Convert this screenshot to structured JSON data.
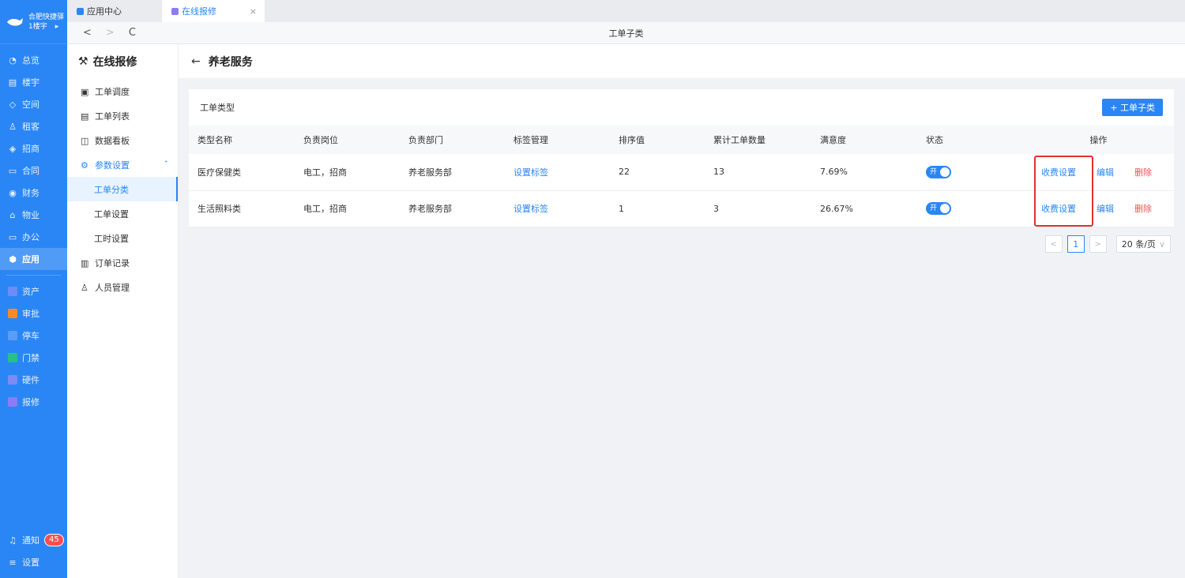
{
  "org": {
    "name": "合肥快捷驿",
    "building": "1楼宇"
  },
  "nav": {
    "items": [
      {
        "label": "总览",
        "icon": "dashboard-icon"
      },
      {
        "label": "楼宇",
        "icon": "building-icon"
      },
      {
        "label": "空间",
        "icon": "cube-icon"
      },
      {
        "label": "租客",
        "icon": "tenant-icon"
      },
      {
        "label": "招商",
        "icon": "tag-icon"
      },
      {
        "label": "合同",
        "icon": "contract-icon"
      },
      {
        "label": "财务",
        "icon": "finance-icon"
      },
      {
        "label": "物业",
        "icon": "home-icon"
      },
      {
        "label": "办公",
        "icon": "monitor-icon"
      },
      {
        "label": "应用",
        "icon": "app-icon"
      }
    ],
    "apps": [
      {
        "label": "资产",
        "color": "#6e8cf7"
      },
      {
        "label": "审批",
        "color": "#f58a2a"
      },
      {
        "label": "停车",
        "color": "#5b9cf7"
      },
      {
        "label": "门禁",
        "color": "#27c08a"
      },
      {
        "label": "硬件",
        "color": "#7b8cf5"
      },
      {
        "label": "报修",
        "color": "#8b7cf6"
      }
    ],
    "notify_label": "通知",
    "notify_count": "45",
    "settings_label": "设置"
  },
  "tabs": [
    {
      "label": "应用中心"
    },
    {
      "label": "在线报修",
      "close": "×"
    }
  ],
  "addr": {
    "back": "<",
    "forward": ">",
    "refresh": "C",
    "title": "工单子类"
  },
  "subside": {
    "title": "在线报修",
    "items": [
      "工单调度",
      "工单列表",
      "数据看板"
    ],
    "group": "参数设置",
    "children": [
      "工单分类",
      "工单设置",
      "工时设置"
    ],
    "after": [
      "订单记录",
      "人员管理"
    ]
  },
  "page": {
    "back": "←",
    "title": "养老服务"
  },
  "card": {
    "label": "工单类型",
    "add_button": "+ 工单子类"
  },
  "table": {
    "headers": [
      "类型名称",
      "负责岗位",
      "负责部门",
      "标签管理",
      "排序值",
      "累计工单数量",
      "满意度",
      "状态",
      "操作"
    ],
    "rows": [
      {
        "name": "医疗保健类",
        "post": "电工，招商",
        "dept": "养老服务部",
        "tag": "设置标签",
        "sort": "22",
        "count": "13",
        "satisfaction": "7.69%",
        "status": "开",
        "fee": "收费设置",
        "edit": "编辑",
        "del": "删除"
      },
      {
        "name": "生活照料类",
        "post": "电工，招商",
        "dept": "养老服务部",
        "tag": "设置标签",
        "sort": "1",
        "count": "3",
        "satisfaction": "26.67%",
        "status": "开",
        "fee": "收费设置",
        "edit": "编辑",
        "del": "删除"
      }
    ]
  },
  "pager": {
    "prev": "<",
    "current": "1",
    "next": ">",
    "size": "20 条/页"
  }
}
